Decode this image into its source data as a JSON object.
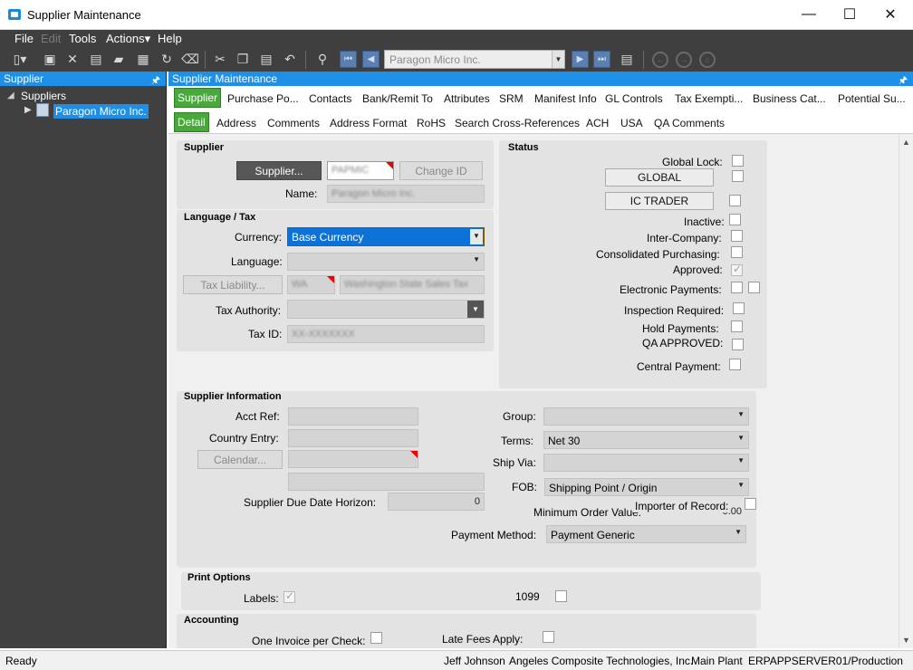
{
  "window": {
    "title": "Supplier Maintenance",
    "min": "—",
    "max": "☐",
    "close": "✕"
  },
  "menu": [
    "File",
    "Edit",
    "Tools",
    "Actions▾",
    "Help"
  ],
  "toolbar": {
    "supplier_combo_value": "Paragon Micro Inc."
  },
  "left_panel": {
    "header": "Supplier",
    "root": "Suppliers",
    "selected_node": "Paragon Micro Inc."
  },
  "main_panel": {
    "header": "Supplier Maintenance"
  },
  "tabs_primary": [
    "Supplier",
    "Purchase Po...",
    "Contacts",
    "Bank/Remit To",
    "Attributes",
    "SRM",
    "Manifest Info",
    "GL Controls",
    "Tax Exempti...",
    "Business Cat...",
    "Potential Su..."
  ],
  "tabs_secondary": [
    "Detail",
    "Address",
    "Comments",
    "Address Format",
    "RoHS",
    "Search Cross-References",
    "ACH",
    "USA",
    "QA Comments"
  ],
  "supplier_group": {
    "title": "Supplier",
    "supplier_button": "Supplier...",
    "supplier_id": "PAPMIC",
    "change_id_button": "Change ID",
    "name_label": "Name:",
    "name_value": "Paragon Micro Inc."
  },
  "language_tax": {
    "title": "Language / Tax",
    "currency_label": "Currency:",
    "currency_value": "Base Currency",
    "language_label": "Language:",
    "language_value": "",
    "tax_liability_button": "Tax Liability...",
    "tax_liability_code": "WA",
    "tax_liability_desc": "Washington State Sales Tax",
    "tax_authority_label": "Tax Authority:",
    "tax_id_label": "Tax ID:",
    "tax_id_value": "XX-XXXXXXX"
  },
  "status": {
    "title": "Status",
    "global_lock": "Global Lock:",
    "global_button": "GLOBAL",
    "ic_trader_button": "IC TRADER",
    "inactive": "Inactive:",
    "inter_company": "Inter-Company:",
    "consolidated_purchasing": "Consolidated Purchasing:",
    "approved": "Approved:",
    "electronic_payments": "Electronic Payments:",
    "inspection_required": "Inspection Required:",
    "hold_payments": "Hold Payments:",
    "qa_approved": "QA APPROVED:",
    "central_payment": "Central Payment:"
  },
  "supplier_info": {
    "title": "Supplier Information",
    "acct_ref": "Acct Ref:",
    "country_entry": "Country Entry:",
    "calendar_button": "Calendar...",
    "due_date_horizon": "Supplier Due Date Horizon:",
    "due_date_horizon_value": "0",
    "group": "Group:",
    "terms": "Terms:",
    "terms_value": "Net 30",
    "ship_via": "Ship Via:",
    "fob": "FOB:",
    "fob_value": "Shipping Point / Origin",
    "importer_of_record": "Importer of Record:",
    "minimum_order_value": "Minimum Order Value:",
    "minimum_order_value_amount": "0.00",
    "payment_method": "Payment Method:",
    "payment_method_value": "Payment Generic"
  },
  "print_options": {
    "title": "Print Options",
    "labels": "Labels:",
    "form_1099": "1099"
  },
  "accounting": {
    "title": "Accounting",
    "one_invoice_per_check": "One Invoice per Check:",
    "late_fees_apply": "Late Fees Apply:"
  },
  "statusbar": {
    "left": "Ready",
    "user": "Jeff Johnson",
    "company": "Angeles Composite Technologies, Inc.",
    "plant": "Main Plant",
    "server": "ERPAPPSERVER01/Production"
  }
}
